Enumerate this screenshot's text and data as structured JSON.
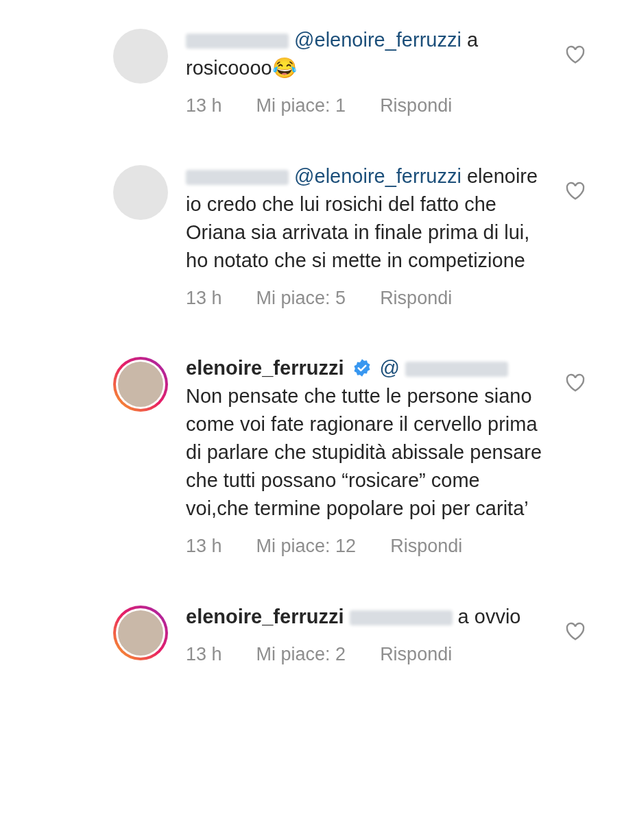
{
  "comments": [
    {
      "story_ring": false,
      "segments": [
        {
          "kind": "hidden"
        },
        {
          "kind": "mention",
          "text": "@elenoire_ferruzzi"
        },
        {
          "kind": "text",
          "text": "a rosicoooo😂"
        }
      ],
      "time": "13 h",
      "likes": "Mi piace: 1",
      "reply": "Rispondi",
      "liked": false
    },
    {
      "story_ring": false,
      "segments": [
        {
          "kind": "hidden"
        },
        {
          "kind": "mention",
          "text": "@elenoire_ferruzzi"
        },
        {
          "kind": "text",
          "text": "elenoire io credo che lui rosichi del fatto che Oriana sia arrivata in finale prima di lui, ho notato che si mette in competizione"
        }
      ],
      "time": "13 h",
      "likes": "Mi piace: 5",
      "reply": "Rispondi",
      "liked": false
    },
    {
      "story_ring": true,
      "segments": [
        {
          "kind": "username",
          "text": "elenoire_ferruzzi",
          "verified": true
        },
        {
          "kind": "mention",
          "text": "@"
        },
        {
          "kind": "hidden"
        },
        {
          "kind": "text",
          "text": "Non pensate che tutte le persone siano come voi fate ragionare il cervello prima di parlare che stupidità abissale pensare che tutti possano “rosicare” come voi,che termine popolare poi per carita’"
        }
      ],
      "time": "13 h",
      "likes": "Mi piace: 12",
      "reply": "Rispondi",
      "liked": false
    },
    {
      "story_ring": true,
      "segments": [
        {
          "kind": "username",
          "text": "elenoire_ferruzzi",
          "verified": false
        },
        {
          "kind": "hidden"
        },
        {
          "kind": "text",
          "text": "a ovvio"
        }
      ],
      "time": "13 h",
      "likes": "Mi piace: 2",
      "reply": "Rispondi",
      "liked": false
    }
  ]
}
